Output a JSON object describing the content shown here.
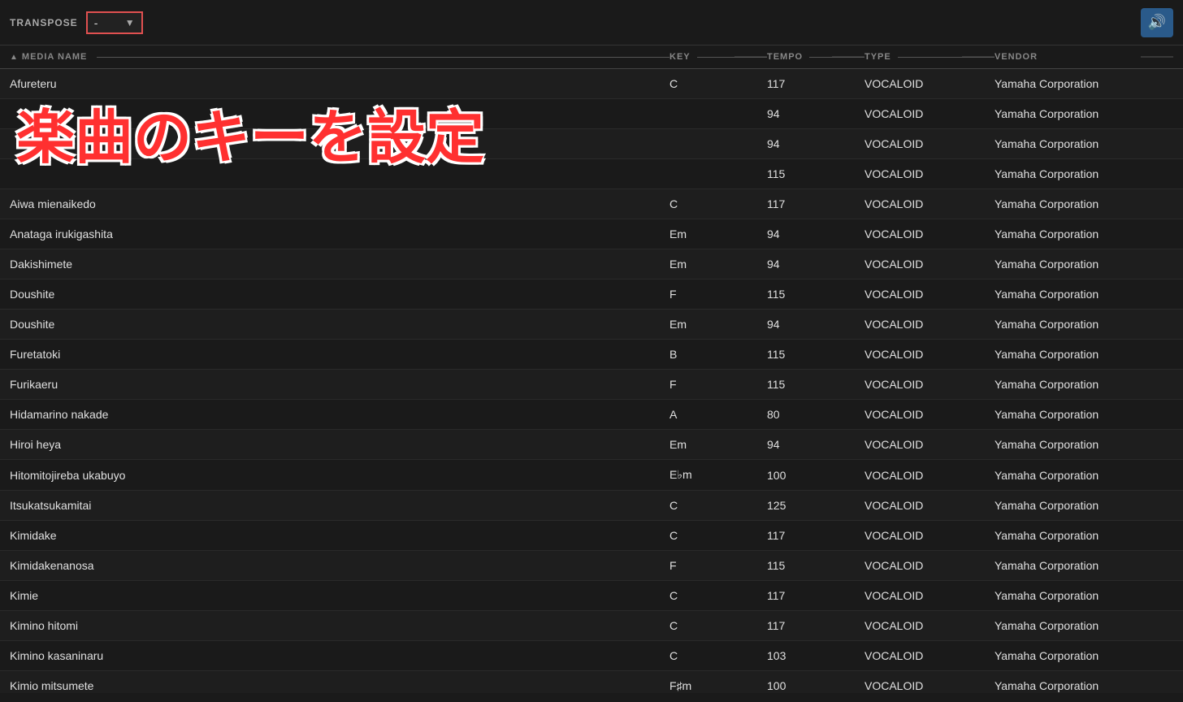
{
  "toolbar": {
    "transpose_label": "TRANSPOSE",
    "transpose_value": "-",
    "sound_icon": "🔊"
  },
  "table": {
    "columns": [
      {
        "id": "name",
        "label": "MEDIA NAME",
        "sortable": true,
        "sort_direction": "asc"
      },
      {
        "id": "key",
        "label": "KEY"
      },
      {
        "id": "tempo",
        "label": "TEMPO"
      },
      {
        "id": "type",
        "label": "TYPE"
      },
      {
        "id": "vendor",
        "label": "VENDOR"
      }
    ],
    "rows": [
      {
        "name": "Afureteru",
        "key": "C",
        "tempo": "117",
        "type": "VOCALOID",
        "vendor": "Yamaha Corporation"
      },
      {
        "name": "",
        "key": "",
        "tempo": "94",
        "type": "VOCALOID",
        "vendor": "Yamaha Corporation"
      },
      {
        "name": "",
        "key": "",
        "tempo": "94",
        "type": "VOCALOID",
        "vendor": "Yamaha Corporation"
      },
      {
        "name": "",
        "key": "",
        "tempo": "115",
        "type": "VOCALOID",
        "vendor": "Yamaha Corporation"
      },
      {
        "name": "Aiwa mienaikedo",
        "key": "C",
        "tempo": "117",
        "type": "VOCALOID",
        "vendor": "Yamaha Corporation"
      },
      {
        "name": "Anataga irukigashita",
        "key": "Em",
        "tempo": "94",
        "type": "VOCALOID",
        "vendor": "Yamaha Corporation"
      },
      {
        "name": "Dakishimete",
        "key": "Em",
        "tempo": "94",
        "type": "VOCALOID",
        "vendor": "Yamaha Corporation"
      },
      {
        "name": "Doushite",
        "key": "F",
        "tempo": "115",
        "type": "VOCALOID",
        "vendor": "Yamaha Corporation"
      },
      {
        "name": "Doushite",
        "key": "Em",
        "tempo": "94",
        "type": "VOCALOID",
        "vendor": "Yamaha Corporation"
      },
      {
        "name": "Furetatoki",
        "key": "B",
        "tempo": "115",
        "type": "VOCALOID",
        "vendor": "Yamaha Corporation"
      },
      {
        "name": "Furikaeru",
        "key": "F",
        "tempo": "115",
        "type": "VOCALOID",
        "vendor": "Yamaha Corporation"
      },
      {
        "name": "Hidamarino nakade",
        "key": "A",
        "tempo": "80",
        "type": "VOCALOID",
        "vendor": "Yamaha Corporation"
      },
      {
        "name": "Hiroi heya",
        "key": "Em",
        "tempo": "94",
        "type": "VOCALOID",
        "vendor": "Yamaha Corporation"
      },
      {
        "name": "Hitomitojireba ukabuyo",
        "key": "E♭m",
        "tempo": "100",
        "type": "VOCALOID",
        "vendor": "Yamaha Corporation"
      },
      {
        "name": "Itsukatsukamitai",
        "key": "C",
        "tempo": "125",
        "type": "VOCALOID",
        "vendor": "Yamaha Corporation"
      },
      {
        "name": "Kimidake",
        "key": "C",
        "tempo": "117",
        "type": "VOCALOID",
        "vendor": "Yamaha Corporation"
      },
      {
        "name": "Kimidakenanosa",
        "key": "F",
        "tempo": "115",
        "type": "VOCALOID",
        "vendor": "Yamaha Corporation"
      },
      {
        "name": "Kimie",
        "key": "C",
        "tempo": "117",
        "type": "VOCALOID",
        "vendor": "Yamaha Corporation"
      },
      {
        "name": "Kimino hitomi",
        "key": "C",
        "tempo": "117",
        "type": "VOCALOID",
        "vendor": "Yamaha Corporation"
      },
      {
        "name": "Kimino kasaninaru",
        "key": "C",
        "tempo": "103",
        "type": "VOCALOID",
        "vendor": "Yamaha Corporation"
      },
      {
        "name": "Kimio mitsumete",
        "key": "F♯m",
        "tempo": "100",
        "type": "VOCALOID",
        "vendor": "Yamaha Corporation"
      }
    ]
  },
  "overlay": {
    "text": "楽曲のキーを設定"
  }
}
